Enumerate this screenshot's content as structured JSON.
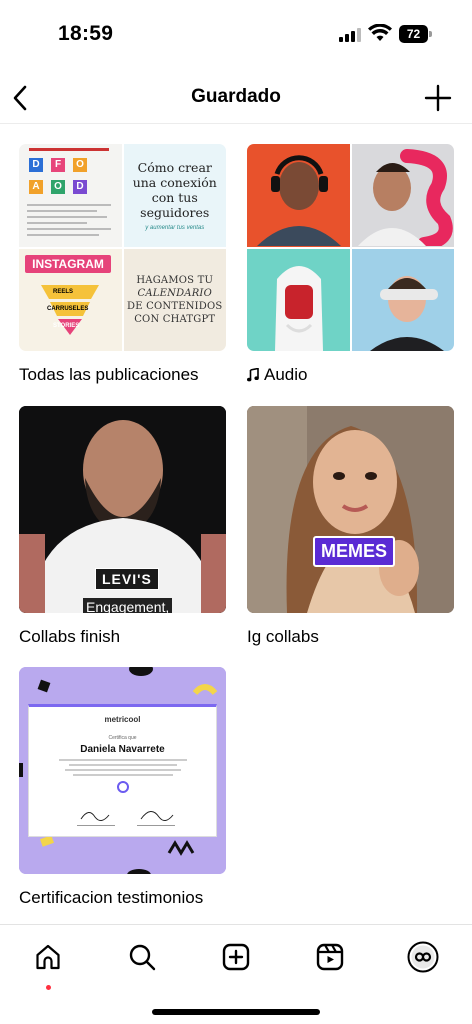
{
  "status_bar": {
    "time": "18:59",
    "battery": "72"
  },
  "header": {
    "title": "Guardado"
  },
  "collections": [
    {
      "label": "Todas las publicaciones",
      "thumbs": {
        "infographic_title": "INSTAGRAM",
        "conexion_line1": "Cómo crear",
        "conexion_line2": "una conexión",
        "conexion_line3": "con tus",
        "conexion_line4": "seguidores",
        "conexion_sub": "y aumentar tus ventas",
        "calendario_line1": "HAGAMOS TU",
        "calendario_line2": "CALENDARIO",
        "calendario_line3": "DE CONTENIDOS",
        "calendario_line4": "CON CHATGPT",
        "funnel_1": "REELS",
        "funnel_2": "CARRUSELES",
        "funnel_3": "STORIES"
      }
    },
    {
      "label": "Audio",
      "icon": "music-note-icon"
    },
    {
      "label": "Collabs finish",
      "thumbs": {
        "shirt": "LEVI'S",
        "caption": "Engagement,"
      }
    },
    {
      "label": "Ig collabs",
      "thumbs": {
        "badge": "MEMES"
      }
    },
    {
      "label": "Certificacion testimonios",
      "thumbs": {
        "brand": "metricool",
        "certifies": "Certifica que",
        "name": "Daniela Navarrete"
      }
    }
  ],
  "tabbar": {
    "items": [
      "home-icon",
      "search-icon",
      "create-icon",
      "reels-icon",
      "profile-icon"
    ]
  },
  "colors": {
    "notification_dot": "#ff3040",
    "accent_purple": "#5a2bd4"
  }
}
